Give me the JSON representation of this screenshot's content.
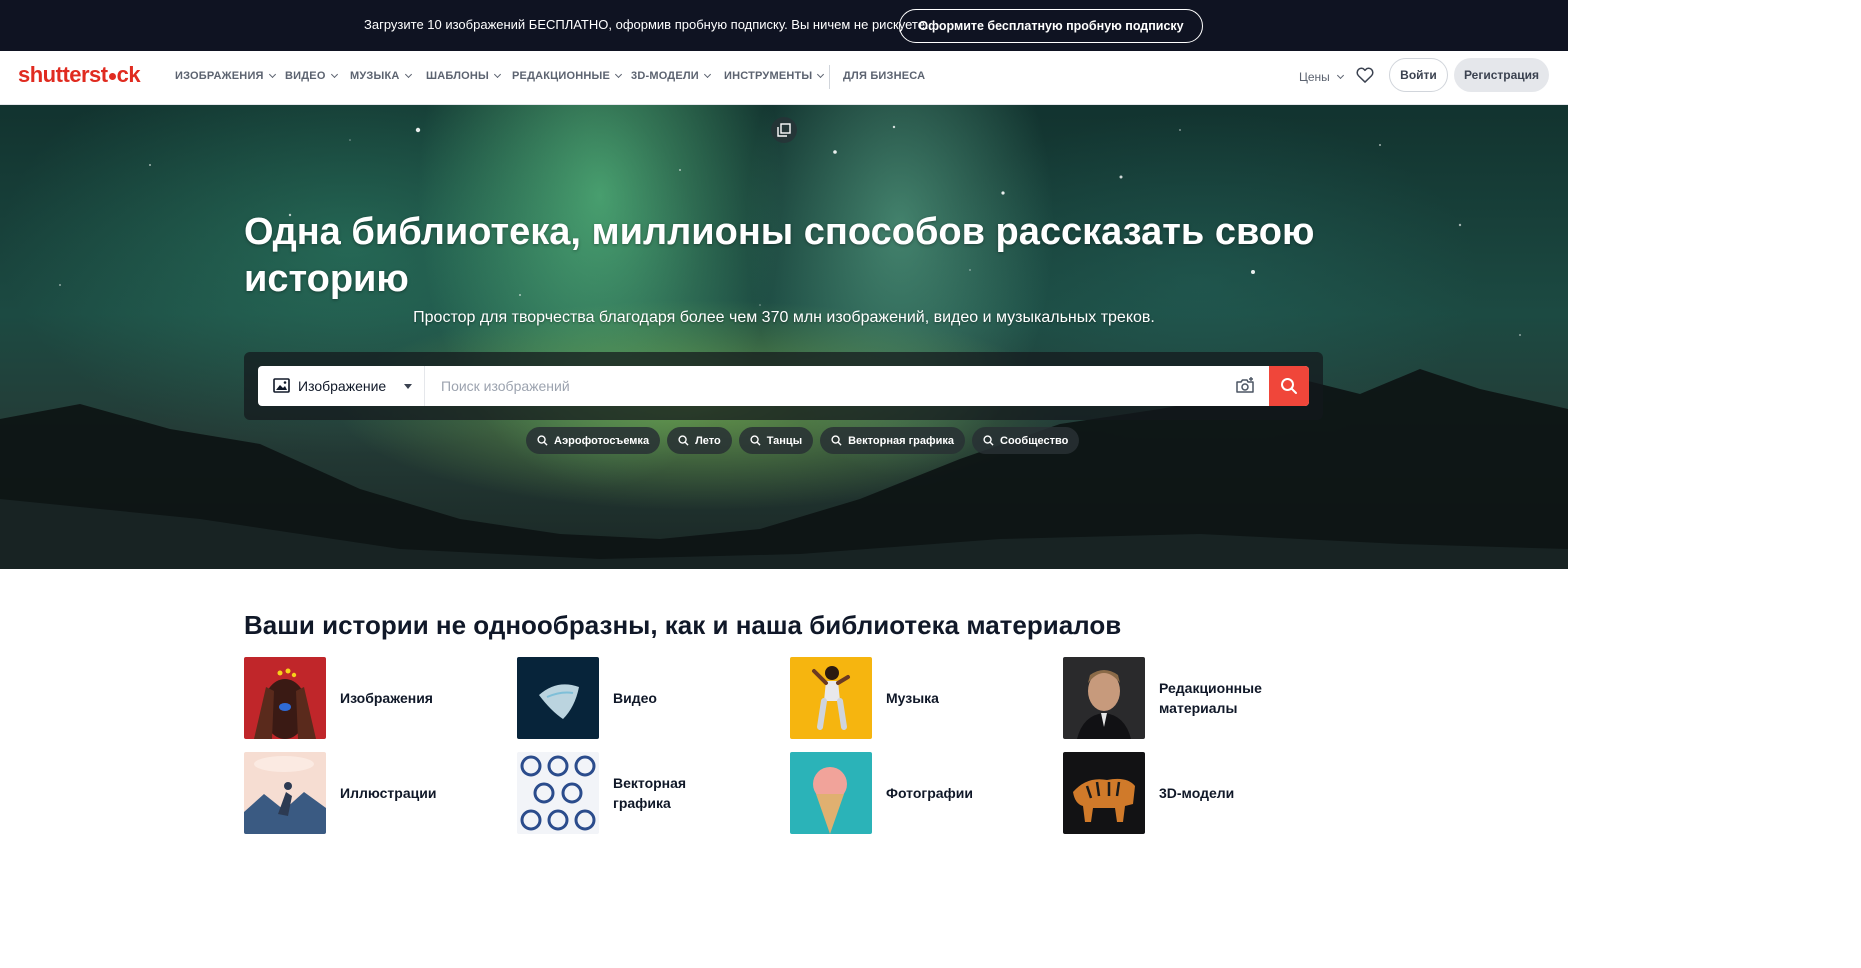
{
  "promo": {
    "text": "Загрузите 10 изображений БЕСПЛАТНО, оформив пробную подписку. Вы ничем не рискуете.",
    "button": "Оформите бесплатную пробную подписку"
  },
  "nav": {
    "logo": {
      "part1": "shutterst",
      "part2": "ck"
    },
    "items": [
      {
        "label": "ИЗОБРАЖЕНИЯ"
      },
      {
        "label": "ВИДЕО"
      },
      {
        "label": "МУЗЫКА"
      },
      {
        "label": "ШАБЛОНЫ"
      },
      {
        "label": "РЕДАКЦИОННЫЕ"
      },
      {
        "label": "3D-МОДЕЛИ"
      },
      {
        "label": "ИНСТРУМЕНТЫ"
      },
      {
        "label": "ДЛЯ БИЗНЕСА"
      }
    ],
    "prices": "Цены",
    "login": "Войти",
    "signup": "Регистрация"
  },
  "hero": {
    "title": "Одна библиотека, миллионы способов рассказать свою историю",
    "subtitle": "Простор для творчества благодаря более чем 370 млн изображений, видео и музыкальных треков.",
    "search": {
      "type_selected": "Изображение",
      "placeholder": "Поиск изображений"
    },
    "chips": [
      "Аэрофотосъемка",
      "Лето",
      "Танцы",
      "Векторная графика",
      "Сообщество"
    ]
  },
  "categories": {
    "title": "Ваши истории не однообразны, как и наша библиотека материалов",
    "items": [
      {
        "label": "Изображения"
      },
      {
        "label": "Видео"
      },
      {
        "label": "Музыка"
      },
      {
        "label": "Редакционные материалы"
      },
      {
        "label": "Иллюстрации"
      },
      {
        "label": "Векторная графика"
      },
      {
        "label": "Фотографии"
      },
      {
        "label": "3D-модели"
      }
    ]
  },
  "colors": {
    "brand": "#e02b20",
    "search_button": "#f0463a",
    "promo_bg": "#0f1322"
  }
}
